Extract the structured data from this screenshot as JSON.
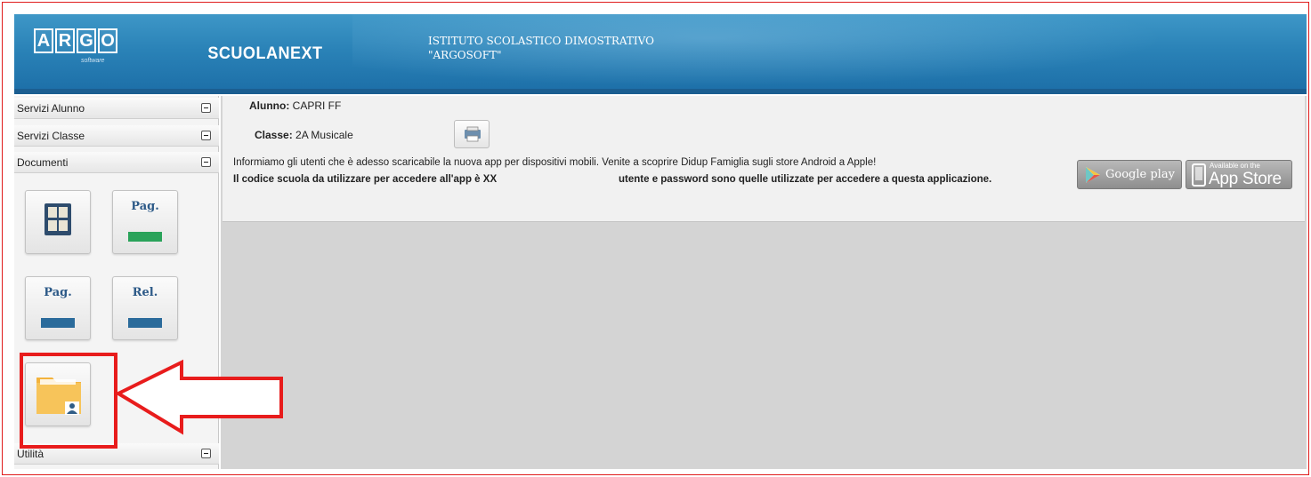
{
  "header": {
    "logo_letters": [
      "A",
      "R",
      "G",
      "O"
    ],
    "logo_sub": "software",
    "brand": "SCUOLANEXT",
    "school_line1": "ISTITUTO SCOLASTICO DIMOSTRATIVO",
    "school_line2": "\"ARGOSOFT\"",
    "colors": {
      "header": "#2a82b7",
      "header_dark": "#1b5e91"
    }
  },
  "sidebar": {
    "sections": [
      {
        "label": "Servizi Alunno",
        "icon": "collapse-toggle-icon"
      },
      {
        "label": "Servizi Classe",
        "icon": "collapse-toggle-icon"
      },
      {
        "label": "Documenti",
        "icon": "collapse-toggle-icon"
      },
      {
        "label": "Utilità",
        "icon": "collapse-toggle-icon"
      }
    ],
    "tiles": [
      {
        "label": "",
        "icon": "grid-documents-icon"
      },
      {
        "label": "Pag.",
        "icon": "report-green-icon",
        "bar_color": "#2aa35a"
      },
      {
        "label": "Pag.",
        "icon": "report-blue-icon",
        "bar_color": "#2b6b9b"
      },
      {
        "label": "Rel.",
        "icon": "report-blue-icon",
        "bar_color": "#2b6b9b"
      },
      {
        "label": "",
        "icon": "folder-user-icon"
      }
    ]
  },
  "main": {
    "student_label": "Alunno:",
    "student_value": "CAPRI FF",
    "class_label": "Classe:",
    "class_value": "2A Musicale",
    "print_icon": "print-icon",
    "notice_line1": "Informiamo gli utenti che è adesso scaricabile la nuova app per dispositivi mobili. Venite a scoprire Didup Famiglia sugli store Android a Apple!",
    "notice_line2_a": "Il codice scuola da utilizzare per accedere all'app è XX",
    "notice_line2_b": "utente e password sono quelle utilizzate per accedere a questa applicazione.",
    "google_play": {
      "small": "",
      "big": "Google play",
      "icon": "play-triangle-icon"
    },
    "app_store": {
      "small": "Available on the",
      "big": "App Store",
      "icon": "phone-icon"
    }
  },
  "annotation": {
    "highlight_color": "#e81c1c",
    "arrow_icon": "left-arrow-icon"
  }
}
